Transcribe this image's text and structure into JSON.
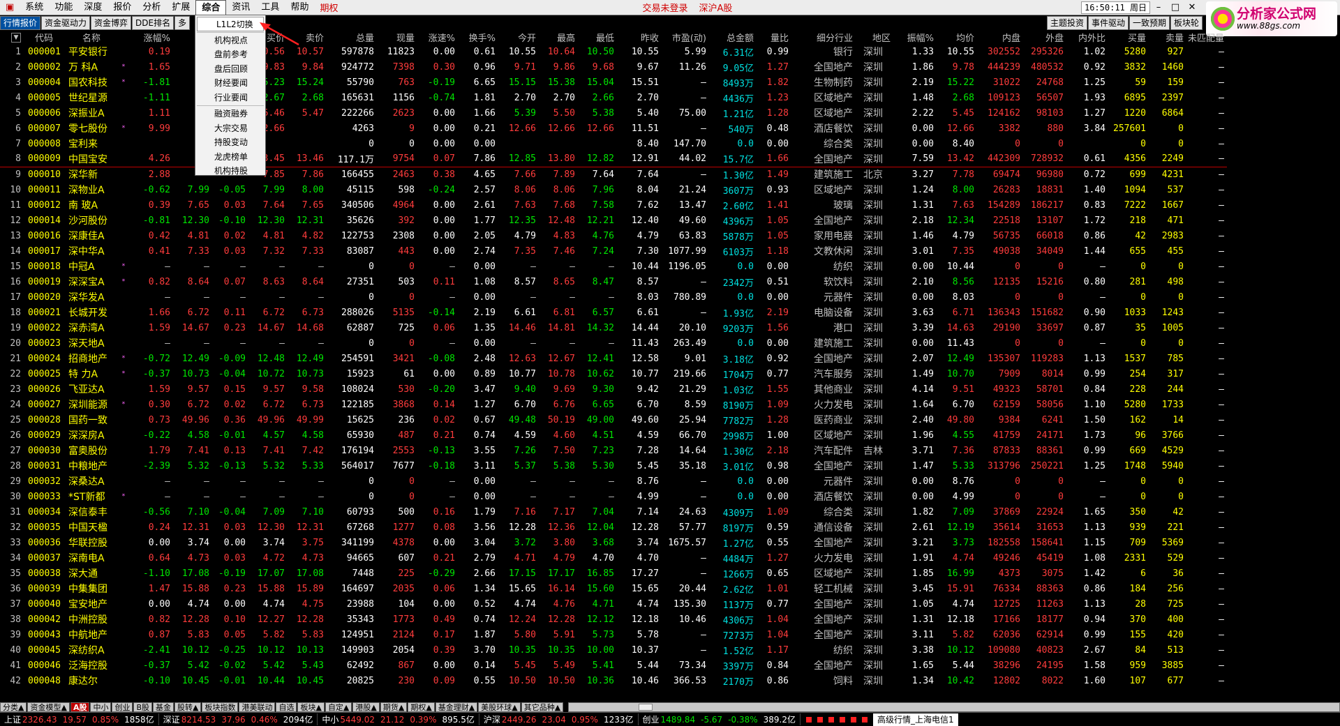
{
  "menu": {
    "items": [
      "系统",
      "功能",
      "深度",
      "报价",
      "分析",
      "扩展",
      "综合",
      "资讯",
      "工具",
      "帮助"
    ],
    "active": "综合",
    "qiquan": "期权",
    "not_logged": "交易未登录",
    "market": "深沪A股",
    "clock": "16:50:11 周日"
  },
  "logo": {
    "text": "分析家公式网",
    "url": "www.88gs.com"
  },
  "toolbar": {
    "left": [
      "行情报价",
      "资金驱动力",
      "资金博弈",
      "DDE排名",
      "多"
    ],
    "right": [
      "主题投资",
      "事件驱动",
      "一致预期",
      "板块轮"
    ]
  },
  "dropdown": [
    "L1L2切换",
    "机构视点",
    "盘前参考",
    "盘后回顾",
    "财经要闻",
    "行业要闻",
    "融资融券",
    "大宗交易",
    "持股变动",
    "龙虎榜单",
    "机构持股"
  ],
  "headers": [
    "",
    "代码",
    "名称",
    "",
    "涨幅%",
    "",
    "",
    "买价",
    "卖价",
    "总量",
    "现量",
    "涨速%",
    "换手%",
    "今开",
    "最高",
    "最低",
    "昨收",
    "市盈(动)",
    "总金额",
    "量比",
    "细分行业",
    "地区",
    "振幅%",
    "均价",
    "内盘",
    "外盘",
    "内外比",
    "买量",
    "卖量",
    "未匹配量"
  ],
  "rows": [
    [
      "1",
      "000001",
      "平安银行",
      "",
      "0.19",
      "",
      "",
      "10.56",
      "10.57",
      "597878",
      "11823",
      "0.00",
      "0.61",
      "10.55",
      "10.64",
      "10.50",
      "10.55",
      "5.99",
      "6.31亿",
      "0.99",
      "银行",
      "深圳",
      "1.33",
      "10.55",
      "302552",
      "295326",
      "1.02",
      "5280",
      "927",
      "—"
    ],
    [
      "2",
      "000002",
      "万 科A",
      "*",
      "1.65",
      "",
      "",
      "9.83",
      "9.84",
      "924772",
      "7398",
      "0.30",
      "0.96",
      "9.71",
      "9.86",
      "9.68",
      "9.67",
      "11.26",
      "9.05亿",
      "1.27",
      "全国地产",
      "深圳",
      "1.86",
      "9.78",
      "444239",
      "480532",
      "0.92",
      "3832",
      "1460",
      "—"
    ],
    [
      "3",
      "000004",
      "国农科技",
      "*",
      "-1.81",
      "",
      "",
      "15.23",
      "15.24",
      "55790",
      "763",
      "-0.19",
      "6.65",
      "15.15",
      "15.38",
      "15.04",
      "15.51",
      "—",
      "8493万",
      "1.82",
      "生物制药",
      "深圳",
      "2.19",
      "15.22",
      "31022",
      "24768",
      "1.25",
      "59",
      "159",
      "—"
    ],
    [
      "4",
      "000005",
      "世纪星源",
      "",
      "-1.11",
      "",
      "",
      "2.67",
      "2.68",
      "165631",
      "1156",
      "-0.74",
      "1.81",
      "2.70",
      "2.70",
      "2.66",
      "2.70",
      "—",
      "4436万",
      "1.23",
      "区域地产",
      "深圳",
      "1.48",
      "2.68",
      "109123",
      "56507",
      "1.93",
      "6895",
      "2397",
      "—"
    ],
    [
      "5",
      "000006",
      "深振业A",
      "",
      "1.11",
      "",
      "",
      "5.46",
      "5.47",
      "222266",
      "2623",
      "0.00",
      "1.66",
      "5.39",
      "5.50",
      "5.38",
      "5.40",
      "75.00",
      "1.21亿",
      "1.28",
      "区域地产",
      "深圳",
      "2.22",
      "5.45",
      "124162",
      "98103",
      "1.27",
      "1220",
      "6864",
      "—"
    ],
    [
      "6",
      "000007",
      "零七股份",
      "*",
      "9.99",
      "",
      "",
      "12.66",
      "",
      "4263",
      "9",
      "0.00",
      "0.21",
      "12.66",
      "12.66",
      "12.66",
      "11.51",
      "—",
      "540万",
      "0.48",
      "酒店餐饮",
      "深圳",
      "0.00",
      "12.66",
      "3382",
      "880",
      "3.84",
      "257601",
      "0",
      "—"
    ],
    [
      "7",
      "000008",
      "宝利来",
      "",
      "",
      "",
      "",
      "",
      "",
      "0",
      "0",
      "0.00",
      "0.00",
      "",
      "",
      "",
      "8.40",
      "147.70",
      "0.0",
      "0.00",
      "综合类",
      "深圳",
      "0.00",
      "8.40",
      "0",
      "0",
      "",
      "0",
      "0",
      "—"
    ],
    [
      "8",
      "000009",
      "中国宝安",
      "",
      "4.26",
      "",
      "",
      "13.45",
      "13.46",
      "117.1万",
      "9754",
      "0.07",
      "7.86",
      "12.85",
      "13.80",
      "12.82",
      "12.91",
      "44.02",
      "15.7亿",
      "1.66",
      "全国地产",
      "深圳",
      "7.59",
      "13.42",
      "442309",
      "728932",
      "0.61",
      "4356",
      "2249",
      "—"
    ],
    [
      "9",
      "000010",
      "深华新",
      "",
      "2.88",
      "",
      "",
      "7.85",
      "7.86",
      "166455",
      "2463",
      "0.38",
      "4.65",
      "7.66",
      "7.89",
      "7.64",
      "7.64",
      "—",
      "1.30亿",
      "1.49",
      "建筑施工",
      "北京",
      "3.27",
      "7.78",
      "69474",
      "96980",
      "0.72",
      "699",
      "4231",
      "—"
    ],
    [
      "10",
      "000011",
      "深物业A",
      "",
      "-0.62",
      "7.99",
      "-0.05",
      "7.99",
      "8.00",
      "45115",
      "598",
      "-0.24",
      "2.57",
      "8.06",
      "8.06",
      "7.96",
      "8.04",
      "21.24",
      "3607万",
      "0.93",
      "区域地产",
      "深圳",
      "1.24",
      "8.00",
      "26283",
      "18831",
      "1.40",
      "1094",
      "537",
      "—"
    ],
    [
      "11",
      "000012",
      "南 玻A",
      "",
      "0.39",
      "7.65",
      "0.03",
      "7.64",
      "7.65",
      "340506",
      "4964",
      "0.00",
      "2.61",
      "7.63",
      "7.68",
      "7.58",
      "7.62",
      "13.47",
      "2.60亿",
      "1.41",
      "玻璃",
      "深圳",
      "1.31",
      "7.63",
      "154289",
      "186217",
      "0.83",
      "7222",
      "1667",
      "—"
    ],
    [
      "12",
      "000014",
      "沙河股份",
      "",
      "-0.81",
      "12.30",
      "-0.10",
      "12.30",
      "12.31",
      "35626",
      "392",
      "0.00",
      "1.77",
      "12.35",
      "12.48",
      "12.21",
      "12.40",
      "49.60",
      "4396万",
      "1.05",
      "全国地产",
      "深圳",
      "2.18",
      "12.34",
      "22518",
      "13107",
      "1.72",
      "218",
      "471",
      "—"
    ],
    [
      "13",
      "000016",
      "深康佳A",
      "",
      "0.42",
      "4.81",
      "0.02",
      "4.81",
      "4.82",
      "122753",
      "2308",
      "0.00",
      "2.05",
      "4.79",
      "4.83",
      "4.76",
      "4.79",
      "63.83",
      "5878万",
      "1.05",
      "家用电器",
      "深圳",
      "1.46",
      "4.79",
      "56735",
      "66018",
      "0.86",
      "42",
      "2983",
      "—"
    ],
    [
      "14",
      "000017",
      "深中华A",
      "",
      "0.41",
      "7.33",
      "0.03",
      "7.32",
      "7.33",
      "83087",
      "443",
      "0.00",
      "2.74",
      "7.35",
      "7.46",
      "7.24",
      "7.30",
      "1077.99",
      "6103万",
      "1.18",
      "文教休闲",
      "深圳",
      "3.01",
      "7.35",
      "49038",
      "34049",
      "1.44",
      "655",
      "455",
      "—"
    ],
    [
      "15",
      "000018",
      "中冠A",
      "*",
      "—",
      "—",
      "—",
      "—",
      "—",
      "0",
      "0",
      "—",
      "0.00",
      "—",
      "—",
      "—",
      "10.44",
      "1196.05",
      "0.0",
      "0.00",
      "纺织",
      "深圳",
      "0.00",
      "10.44",
      "0",
      "0",
      "—",
      "0",
      "0",
      "—"
    ],
    [
      "16",
      "000019",
      "深深宝A",
      "*",
      "0.82",
      "8.64",
      "0.07",
      "8.63",
      "8.64",
      "27351",
      "503",
      "0.11",
      "1.08",
      "8.57",
      "8.65",
      "8.47",
      "8.57",
      "—",
      "2342万",
      "0.51",
      "软饮料",
      "深圳",
      "2.10",
      "8.56",
      "12135",
      "15216",
      "0.80",
      "281",
      "498",
      "—"
    ],
    [
      "17",
      "000020",
      "深华发A",
      "",
      "—",
      "—",
      "—",
      "—",
      "—",
      "0",
      "0",
      "—",
      "0.00",
      "—",
      "—",
      "—",
      "8.03",
      "780.89",
      "0.0",
      "0.00",
      "元器件",
      "深圳",
      "0.00",
      "8.03",
      "0",
      "0",
      "—",
      "0",
      "0",
      "—"
    ],
    [
      "18",
      "000021",
      "长城开发",
      "",
      "1.66",
      "6.72",
      "0.11",
      "6.72",
      "6.73",
      "288026",
      "5135",
      "-0.14",
      "2.19",
      "6.61",
      "6.81",
      "6.57",
      "6.61",
      "—",
      "1.93亿",
      "2.19",
      "电脑设备",
      "深圳",
      "3.63",
      "6.71",
      "136343",
      "151682",
      "0.90",
      "1033",
      "1243",
      "—"
    ],
    [
      "19",
      "000022",
      "深赤湾A",
      "",
      "1.59",
      "14.67",
      "0.23",
      "14.67",
      "14.68",
      "62887",
      "725",
      "0.06",
      "1.35",
      "14.46",
      "14.81",
      "14.32",
      "14.44",
      "20.10",
      "9203万",
      "1.56",
      "港口",
      "深圳",
      "3.39",
      "14.63",
      "29190",
      "33697",
      "0.87",
      "35",
      "1005",
      "—"
    ],
    [
      "20",
      "000023",
      "深天地A",
      "",
      "—",
      "—",
      "—",
      "—",
      "—",
      "0",
      "0",
      "—",
      "0.00",
      "—",
      "—",
      "—",
      "11.43",
      "263.49",
      "0.0",
      "0.00",
      "建筑施工",
      "深圳",
      "0.00",
      "11.43",
      "0",
      "0",
      "—",
      "0",
      "0",
      "—"
    ],
    [
      "21",
      "000024",
      "招商地产",
      "*",
      "-0.72",
      "12.49",
      "-0.09",
      "12.48",
      "12.49",
      "254591",
      "3421",
      "-0.08",
      "2.48",
      "12.63",
      "12.67",
      "12.41",
      "12.58",
      "9.01",
      "3.18亿",
      "0.92",
      "全国地产",
      "深圳",
      "2.07",
      "12.49",
      "135307",
      "119283",
      "1.13",
      "1537",
      "785",
      "—"
    ],
    [
      "22",
      "000025",
      "特 力A",
      "*",
      "-0.37",
      "10.73",
      "-0.04",
      "10.72",
      "10.73",
      "15923",
      "61",
      "0.00",
      "0.89",
      "10.77",
      "10.78",
      "10.62",
      "10.77",
      "219.66",
      "1704万",
      "0.77",
      "汽车服务",
      "深圳",
      "1.49",
      "10.70",
      "7909",
      "8014",
      "0.99",
      "254",
      "317",
      "—"
    ],
    [
      "23",
      "000026",
      "飞亚达A",
      "",
      "1.59",
      "9.57",
      "0.15",
      "9.57",
      "9.58",
      "108024",
      "530",
      "-0.20",
      "3.47",
      "9.40",
      "9.69",
      "9.30",
      "9.42",
      "21.29",
      "1.03亿",
      "1.55",
      "其他商业",
      "深圳",
      "4.14",
      "9.51",
      "49323",
      "58701",
      "0.84",
      "228",
      "244",
      "—"
    ],
    [
      "24",
      "000027",
      "深圳能源",
      "*",
      "0.30",
      "6.72",
      "0.02",
      "6.72",
      "6.73",
      "122185",
      "3868",
      "0.14",
      "1.27",
      "6.70",
      "6.76",
      "6.65",
      "6.70",
      "8.59",
      "8190万",
      "1.09",
      "火力发电",
      "深圳",
      "1.64",
      "6.70",
      "62159",
      "58056",
      "1.10",
      "5280",
      "1733",
      "—"
    ],
    [
      "25",
      "000028",
      "国药一致",
      "",
      "0.73",
      "49.96",
      "0.36",
      "49.96",
      "49.99",
      "15625",
      "236",
      "0.02",
      "0.67",
      "49.48",
      "50.19",
      "49.00",
      "49.60",
      "25.94",
      "7782万",
      "1.28",
      "医药商业",
      "深圳",
      "2.40",
      "49.80",
      "9384",
      "6241",
      "1.50",
      "162",
      "14",
      "—"
    ],
    [
      "26",
      "000029",
      "深深房A",
      "",
      "-0.22",
      "4.58",
      "-0.01",
      "4.57",
      "4.58",
      "65930",
      "487",
      "0.21",
      "0.74",
      "4.59",
      "4.60",
      "4.51",
      "4.59",
      "66.70",
      "2998万",
      "1.00",
      "区域地产",
      "深圳",
      "1.96",
      "4.55",
      "41759",
      "24171",
      "1.73",
      "96",
      "3766",
      "—"
    ],
    [
      "27",
      "000030",
      "富奥股份",
      "",
      "1.79",
      "7.41",
      "0.13",
      "7.41",
      "7.42",
      "176194",
      "2553",
      "-0.13",
      "3.55",
      "7.26",
      "7.50",
      "7.23",
      "7.28",
      "14.64",
      "1.30亿",
      "2.18",
      "汽车配件",
      "吉林",
      "3.71",
      "7.36",
      "87833",
      "88361",
      "0.99",
      "669",
      "4529",
      "—"
    ],
    [
      "28",
      "000031",
      "中粮地产",
      "",
      "-2.39",
      "5.32",
      "-0.13",
      "5.32",
      "5.33",
      "564017",
      "7677",
      "-0.18",
      "3.11",
      "5.37",
      "5.38",
      "5.30",
      "5.45",
      "35.18",
      "3.01亿",
      "0.98",
      "全国地产",
      "深圳",
      "1.47",
      "5.33",
      "313796",
      "250221",
      "1.25",
      "1748",
      "5940",
      "—"
    ],
    [
      "29",
      "000032",
      "深桑达A",
      "",
      "—",
      "—",
      "—",
      "—",
      "—",
      "0",
      "0",
      "—",
      "0.00",
      "—",
      "—",
      "—",
      "8.76",
      "—",
      "0.0",
      "0.00",
      "元器件",
      "深圳",
      "0.00",
      "8.76",
      "0",
      "0",
      "—",
      "0",
      "0",
      "—"
    ],
    [
      "30",
      "000033",
      "*ST新都",
      "*",
      "—",
      "—",
      "—",
      "—",
      "—",
      "0",
      "0",
      "—",
      "0.00",
      "—",
      "—",
      "—",
      "4.99",
      "—",
      "0.0",
      "0.00",
      "酒店餐饮",
      "深圳",
      "0.00",
      "4.99",
      "0",
      "0",
      "—",
      "0",
      "0",
      "—"
    ],
    [
      "31",
      "000034",
      "深信泰丰",
      "",
      "-0.56",
      "7.10",
      "-0.04",
      "7.09",
      "7.10",
      "60793",
      "500",
      "0.16",
      "1.79",
      "7.16",
      "7.17",
      "7.04",
      "7.14",
      "24.63",
      "4309万",
      "1.09",
      "综合类",
      "深圳",
      "1.82",
      "7.09",
      "37869",
      "22924",
      "1.65",
      "350",
      "42",
      "—"
    ],
    [
      "32",
      "000035",
      "中国天楹",
      "",
      "0.24",
      "12.31",
      "0.03",
      "12.30",
      "12.31",
      "67268",
      "1277",
      "0.08",
      "3.56",
      "12.28",
      "12.36",
      "12.04",
      "12.28",
      "57.77",
      "8197万",
      "0.59",
      "通信设备",
      "深圳",
      "2.61",
      "12.19",
      "35614",
      "31653",
      "1.13",
      "939",
      "221",
      "—"
    ],
    [
      "33",
      "000036",
      "华联控股",
      "",
      "0.00",
      "3.74",
      "0.00",
      "3.74",
      "3.75",
      "341199",
      "4378",
      "0.00",
      "3.04",
      "3.72",
      "3.80",
      "3.68",
      "3.74",
      "1675.57",
      "1.27亿",
      "0.55",
      "全国地产",
      "深圳",
      "3.21",
      "3.73",
      "182558",
      "158641",
      "1.15",
      "709",
      "5369",
      "—"
    ],
    [
      "34",
      "000037",
      "深南电A",
      "",
      "0.64",
      "4.73",
      "0.03",
      "4.72",
      "4.73",
      "94665",
      "607",
      "0.21",
      "2.79",
      "4.71",
      "4.79",
      "4.70",
      "4.70",
      "—",
      "4484万",
      "1.27",
      "火力发电",
      "深圳",
      "1.91",
      "4.74",
      "49246",
      "45419",
      "1.08",
      "2331",
      "529",
      "—"
    ],
    [
      "35",
      "000038",
      "深大通",
      "",
      "-1.10",
      "17.08",
      "-0.19",
      "17.07",
      "17.08",
      "7448",
      "225",
      "-0.29",
      "2.66",
      "17.15",
      "17.17",
      "16.85",
      "17.27",
      "—",
      "1266万",
      "0.65",
      "区域地产",
      "深圳",
      "1.85",
      "16.99",
      "4373",
      "3075",
      "1.42",
      "6",
      "36",
      "—"
    ],
    [
      "36",
      "000039",
      "中集集团",
      "",
      "1.47",
      "15.88",
      "0.23",
      "15.88",
      "15.89",
      "164697",
      "2035",
      "0.06",
      "1.34",
      "15.65",
      "16.14",
      "15.60",
      "15.65",
      "20.44",
      "2.62亿",
      "1.01",
      "轻工机械",
      "深圳",
      "3.45",
      "15.91",
      "76334",
      "88363",
      "0.86",
      "184",
      "256",
      "—"
    ],
    [
      "37",
      "000040",
      "宝安地产",
      "",
      "0.00",
      "4.74",
      "0.00",
      "4.74",
      "4.75",
      "23988",
      "104",
      "0.00",
      "0.52",
      "4.74",
      "4.76",
      "4.71",
      "4.74",
      "135.30",
      "1137万",
      "0.77",
      "全国地产",
      "深圳",
      "1.05",
      "4.74",
      "12725",
      "11263",
      "1.13",
      "28",
      "725",
      "—"
    ],
    [
      "38",
      "000042",
      "中洲控股",
      "",
      "0.82",
      "12.28",
      "0.10",
      "12.27",
      "12.28",
      "35343",
      "1773",
      "0.49",
      "0.74",
      "12.24",
      "12.28",
      "12.12",
      "12.18",
      "10.46",
      "4306万",
      "1.04",
      "全国地产",
      "深圳",
      "1.31",
      "12.18",
      "17166",
      "18177",
      "0.94",
      "370",
      "400",
      "—"
    ],
    [
      "39",
      "000043",
      "中航地产",
      "",
      "0.87",
      "5.83",
      "0.05",
      "5.82",
      "5.83",
      "124951",
      "2124",
      "0.17",
      "1.87",
      "5.80",
      "5.91",
      "5.73",
      "5.78",
      "—",
      "7273万",
      "1.04",
      "全国地产",
      "深圳",
      "3.11",
      "5.82",
      "62036",
      "62914",
      "0.99",
      "155",
      "420",
      "—"
    ],
    [
      "40",
      "000045",
      "深纺织A",
      "",
      "-2.41",
      "10.12",
      "-0.25",
      "10.12",
      "10.13",
      "149903",
      "2054",
      "0.39",
      "3.70",
      "10.35",
      "10.35",
      "10.00",
      "10.37",
      "—",
      "1.52亿",
      "1.17",
      "纺织",
      "深圳",
      "3.38",
      "10.12",
      "109080",
      "40823",
      "2.67",
      "84",
      "513",
      "—"
    ],
    [
      "41",
      "000046",
      "泛海控股",
      "",
      "-0.37",
      "5.42",
      "-0.02",
      "5.42",
      "5.43",
      "62492",
      "867",
      "0.00",
      "0.14",
      "5.45",
      "5.49",
      "5.41",
      "5.44",
      "73.34",
      "3397万",
      "0.84",
      "全国地产",
      "深圳",
      "1.65",
      "5.44",
      "38296",
      "24195",
      "1.58",
      "959",
      "3885",
      "—"
    ],
    [
      "42",
      "000048",
      "康达尔",
      "",
      "-0.10",
      "10.45",
      "-0.01",
      "10.44",
      "10.45",
      "20825",
      "230",
      "0.09",
      "0.55",
      "10.50",
      "10.50",
      "10.36",
      "10.46",
      "366.53",
      "2170万",
      "0.86",
      "饲料",
      "深圳",
      "1.34",
      "10.42",
      "12802",
      "8022",
      "1.60",
      "107",
      "677",
      "—"
    ]
  ],
  "tabs": [
    "分类▲",
    "资金模型▲",
    "A股",
    "中小",
    "创业",
    "B股",
    "基金",
    "股转▲",
    "板块指数",
    "港美联动",
    "自选",
    "板块▲",
    "自定▲",
    "港股▲",
    "期货▲",
    "期权▲",
    "基金理财▲",
    "美股环球▲",
    "其它品种▲"
  ],
  "tabs_selected": "A股",
  "status": {
    "sh_label": "上证",
    "sh": "2326.43",
    "sh_chg": "19.57",
    "sh_pct": "0.85%",
    "sh_amt": "1858亿",
    "sz_label": "深证",
    "sz": "8214.53",
    "sz_chg": "37.96",
    "sz_pct": "0.46%",
    "sz_amt": "2094亿",
    "zx_label": "中小",
    "zx": "5449.02",
    "zx_chg": "21.12",
    "zx_pct": "0.39%",
    "zx_amt": "895.5亿",
    "hs_label": "沪深",
    "hs": "2449.26",
    "hs_chg": "23.04",
    "hs_pct": "0.95%",
    "hs_amt": "1233亿",
    "cy_label": "创业",
    "cy": "1489.84",
    "cy_chg": "-5.67",
    "cy_pct": "-0.38%",
    "cy_amt": "389.2亿",
    "hq": "高级行情_上海电信1"
  },
  "colors": {
    "up": "#ff3c3c",
    "down": "#00e600",
    "code": "#ffff00"
  }
}
